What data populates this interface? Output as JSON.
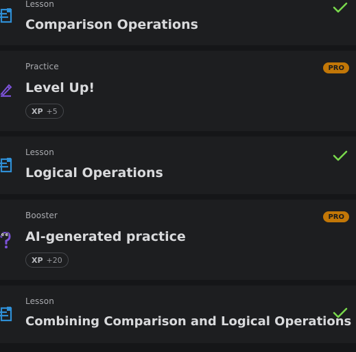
{
  "colors": {
    "background": "#151618",
    "card": "#1d1e20",
    "lesson_icon": "#2f8fd6",
    "practice_icon": "#7c52d9",
    "check": "#79d94c",
    "pro_badge": "#c27707"
  },
  "items": [
    {
      "kind": "Lesson",
      "title": "Comparison Operations",
      "icon": "lesson-doc-icon",
      "status": "completed-check-icon"
    },
    {
      "kind": "Practice",
      "title": "Level Up!",
      "icon": "pencil-practice-icon",
      "badge": "PRO",
      "xp_label": "XP",
      "xp_amount": "+5"
    },
    {
      "kind": "Lesson",
      "title": "Logical Operations",
      "icon": "lesson-doc-icon",
      "status": "completed-check-icon"
    },
    {
      "kind": "Booster",
      "title": "AI-generated practice",
      "icon": "question-booster-icon",
      "badge": "PRO",
      "xp_label": "XP",
      "xp_amount": "+20"
    },
    {
      "kind": "Lesson",
      "title": "Combining Comparison and Logical Operations",
      "icon": "lesson-doc-icon",
      "status": "completed-check-icon"
    }
  ]
}
